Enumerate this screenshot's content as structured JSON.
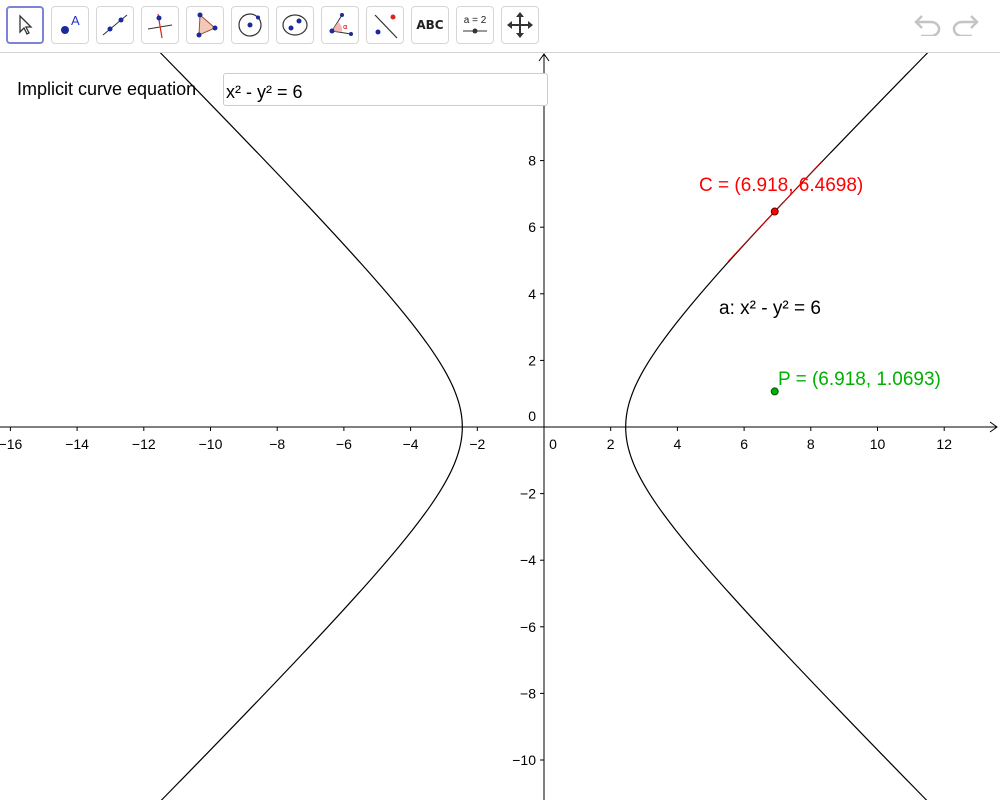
{
  "toolbar": {
    "tools": [
      {
        "name": "move-tool-icon",
        "selected": true
      },
      {
        "name": "point-tool-icon"
      },
      {
        "name": "line-tool-icon"
      },
      {
        "name": "perpendicular-line-tool-icon"
      },
      {
        "name": "polygon-tool-icon"
      },
      {
        "name": "circle-tool-icon"
      },
      {
        "name": "ellipse-tool-icon"
      },
      {
        "name": "angle-tool-icon"
      },
      {
        "name": "reflect-tool-icon"
      },
      {
        "name": "text-tool-icon",
        "label": "ABC"
      },
      {
        "name": "slider-tool-icon",
        "label": "a = 2"
      },
      {
        "name": "move-graphics-view-tool-icon"
      }
    ],
    "undo": "undo-icon",
    "redo": "redo-icon"
  },
  "input": {
    "label": "Implicit curve equation",
    "value": "x² - y² = 6"
  },
  "graph": {
    "x_ticks": [
      "−16",
      "−14",
      "−12",
      "−10",
      "−8",
      "−6",
      "−4",
      "−2",
      "0",
      "2",
      "4",
      "6",
      "8",
      "10",
      "12"
    ],
    "x_tick_values": [
      -16,
      -14,
      -12,
      -10,
      -8,
      -6,
      -4,
      -2,
      0,
      2,
      4,
      6,
      8,
      10,
      12
    ],
    "y_ticks": [
      "8",
      "6",
      "4",
      "2",
      "0",
      "−2",
      "−4",
      "−6",
      "−8",
      "−10"
    ],
    "y_tick_values": [
      8,
      6,
      4,
      2,
      0,
      -2,
      -4,
      -6,
      -8,
      -10
    ],
    "curve": {
      "equation_value": 6,
      "label": "a: x² - y² = 6",
      "color": "#000000"
    },
    "point_C": {
      "x": 6.918,
      "y": 6.4698,
      "label": "C = (6.918, 6.4698)",
      "color": "#ff0000"
    },
    "point_P": {
      "x": 6.918,
      "y": 1.0693,
      "label": "P = (6.918, 1.0693)",
      "color": "#00b000"
    }
  }
}
